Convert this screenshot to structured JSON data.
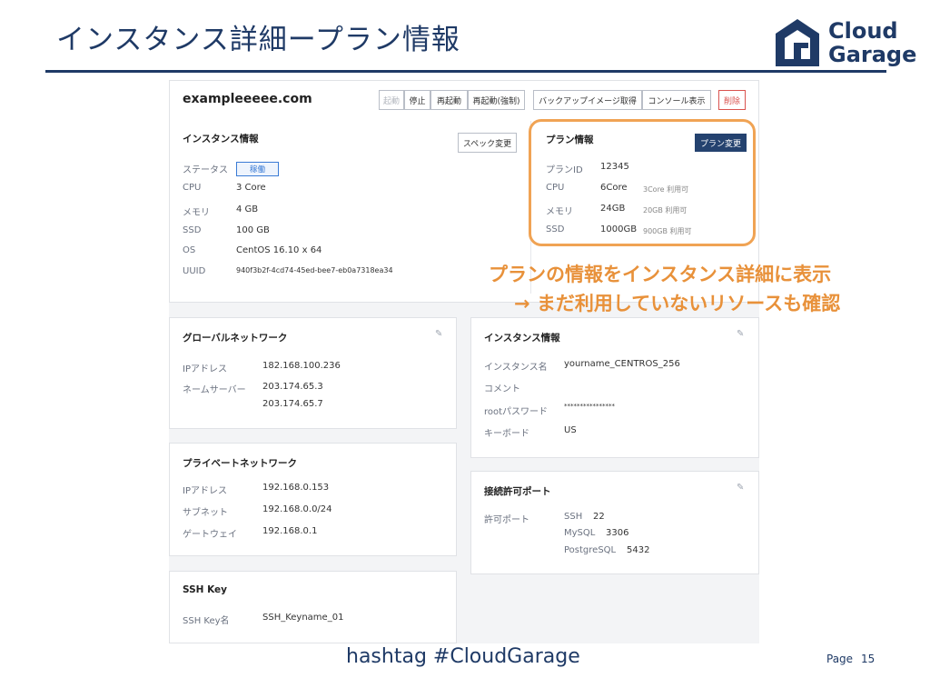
{
  "slide": {
    "title": "インスタンス詳細ープラン情報",
    "footer_hashtag": "hashtag  #CloudGarage",
    "page_label": "Page",
    "page_number": "15",
    "logo_line1": "Cloud",
    "logo_line2": "Garage"
  },
  "screen": {
    "hostname": "exampleeeee.com",
    "toolbar": {
      "start": "起動",
      "stop": "停止",
      "restart": "再起動",
      "force_restart": "再起動(強制)",
      "backup": "バックアップイメージ取得",
      "console": "コンソール表示",
      "delete": "削除"
    },
    "instance_info": {
      "title": "インスタンス情報",
      "spec_button": "スペック変更",
      "rows": [
        {
          "label": "ステータス",
          "value": "稼働"
        },
        {
          "label": "CPU",
          "value": "3 Core"
        },
        {
          "label": "メモリ",
          "value": "4 GB"
        },
        {
          "label": "SSD",
          "value": "100 GB"
        },
        {
          "label": "OS",
          "value": "CentOS 16.10 x 64"
        },
        {
          "label": "UUID",
          "value": "940f3b2f-4cd74-45ed-bee7-eb0a7318ea34"
        }
      ]
    },
    "plan_info": {
      "title": "プラン情報",
      "change_button": "プラン変更",
      "rows": [
        {
          "label": "プランID",
          "value": "12345",
          "note": ""
        },
        {
          "label": "CPU",
          "value": "6Core",
          "note": "3Core 利用可"
        },
        {
          "label": "メモリ",
          "value": "24GB",
          "note": "20GB 利用可"
        },
        {
          "label": "SSD",
          "value": "1000GB",
          "note": "900GB 利用可"
        }
      ]
    },
    "global_network": {
      "title": "グローバルネットワーク",
      "ip_label": "IPアドレス",
      "ip_value": "182.168.100.236",
      "ns_label": "ネームサーバー",
      "ns_values": [
        "203.174.65.3",
        "203.174.65.7"
      ]
    },
    "instance_info2": {
      "title": "インスタンス情報",
      "rows": [
        {
          "label": "インスタンス名",
          "value": "yourname_CENTROS_256"
        },
        {
          "label": "コメント",
          "value": ""
        },
        {
          "label": "rootパスワード",
          "value": "****************"
        },
        {
          "label": "キーボード",
          "value": "US"
        }
      ]
    },
    "private_network": {
      "title": "プライベートネットワーク",
      "rows": [
        {
          "label": "IPアドレス",
          "value": "192.168.0.153"
        },
        {
          "label": "サブネット",
          "value": "192.168.0.0/24"
        },
        {
          "label": "ゲートウェイ",
          "value": "192.168.0.1"
        }
      ]
    },
    "ports": {
      "title": "接続許可ポート",
      "label": "許可ポート",
      "rows": [
        {
          "name": "SSH",
          "port": "22"
        },
        {
          "name": "MySQL",
          "port": "3306"
        },
        {
          "name": "PostgreSQL",
          "port": "5432"
        }
      ]
    },
    "ssh_key": {
      "title": "SSH Key",
      "label": "SSH Key名",
      "value": "SSH_Keyname_01"
    }
  },
  "annotation": {
    "line1": "プランの情報をインスタンス詳細に表示",
    "line2": "→ まだ利用していないリソースも確認"
  },
  "colors": {
    "brand_navy": "#1f3a66",
    "highlight_orange": "#f0a354",
    "annotation_orange": "#e8913a",
    "delete_red": "#d9534f"
  }
}
